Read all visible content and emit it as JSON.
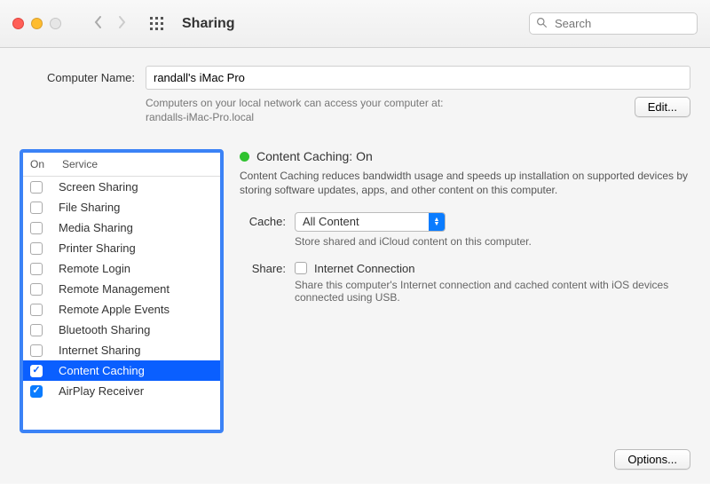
{
  "window": {
    "title": "Sharing",
    "search_placeholder": "Search"
  },
  "computer": {
    "label": "Computer Name:",
    "name": "randall's iMac Pro",
    "access_text": "Computers on your local network can access your computer at:",
    "hostname": "randalls-iMac-Pro.local",
    "edit_label": "Edit..."
  },
  "services": {
    "header_on": "On",
    "header_service": "Service",
    "items": [
      {
        "label": "Screen Sharing",
        "checked": false,
        "selected": false
      },
      {
        "label": "File Sharing",
        "checked": false,
        "selected": false
      },
      {
        "label": "Media Sharing",
        "checked": false,
        "selected": false
      },
      {
        "label": "Printer Sharing",
        "checked": false,
        "selected": false
      },
      {
        "label": "Remote Login",
        "checked": false,
        "selected": false
      },
      {
        "label": "Remote Management",
        "checked": false,
        "selected": false
      },
      {
        "label": "Remote Apple Events",
        "checked": false,
        "selected": false
      },
      {
        "label": "Bluetooth Sharing",
        "checked": false,
        "selected": false
      },
      {
        "label": "Internet Sharing",
        "checked": false,
        "selected": false
      },
      {
        "label": "Content Caching",
        "checked": true,
        "selected": true
      },
      {
        "label": "AirPlay Receiver",
        "checked": true,
        "selected": false
      }
    ]
  },
  "detail": {
    "status_label": "Content Caching: On",
    "status_color": "#30c230",
    "description": "Content Caching reduces bandwidth usage and speeds up installation on supported devices by storing software updates, apps, and other content on this computer.",
    "cache_label": "Cache:",
    "cache_value": "All Content",
    "cache_hint": "Store shared and iCloud content on this computer.",
    "share_label": "Share:",
    "share_option": "Internet Connection",
    "share_hint": "Share this computer's Internet connection and cached content with iOS devices connected using USB.",
    "options_label": "Options..."
  }
}
